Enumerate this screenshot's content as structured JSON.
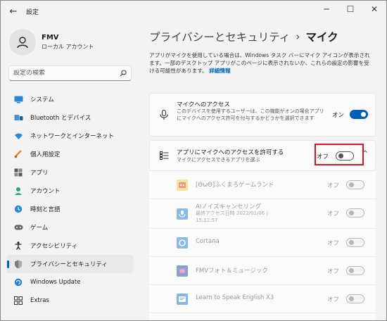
{
  "window": {
    "title": "設定",
    "back_icon": "←",
    "minimize_icon": "─",
    "maximize_icon": "☐",
    "close_icon": "✕"
  },
  "user": {
    "name": "FMV",
    "account_type": "ローカル アカウント"
  },
  "search": {
    "placeholder": "設定の検索"
  },
  "sidebar": {
    "items": [
      {
        "label": "システム",
        "icon": "system-icon"
      },
      {
        "label": "Bluetooth とデバイス",
        "icon": "bluetooth-icon"
      },
      {
        "label": "ネットワークとインターネット",
        "icon": "network-icon"
      },
      {
        "label": "個人用設定",
        "icon": "personalization-icon"
      },
      {
        "label": "アプリ",
        "icon": "apps-icon"
      },
      {
        "label": "アカウント",
        "icon": "account-icon"
      },
      {
        "label": "時刻と言語",
        "icon": "time-language-icon"
      },
      {
        "label": "ゲーム",
        "icon": "gaming-icon"
      },
      {
        "label": "アクセシビリティ",
        "icon": "accessibility-icon"
      },
      {
        "label": "プライバシーとセキュリティ",
        "icon": "privacy-shield-icon",
        "active": true
      },
      {
        "label": "Windows Update",
        "icon": "windows-update-icon"
      },
      {
        "label": "Extras",
        "icon": "extras-icon"
      }
    ]
  },
  "breadcrumb": {
    "parent": "プライバシーとセキュリティ",
    "separator": "›",
    "current": "マイク"
  },
  "description": {
    "text": "アプリがマイクを使用している場合は、Windows タスク バーにマイク アイコンが表示されます。一部のデスクトップ アプリがこのページに表示されないか、これらの設定の影響を受ける可能性があります。",
    "more_link": "詳細情報"
  },
  "mic_access": {
    "title": "マイクへのアクセス",
    "subtitle": "このデバイスを使用するユーザーは、この機能がオンの場合アプリにマイクへのアクセス許可を付与するかどうかを選択できます",
    "toggle_label": "オン",
    "state": "on"
  },
  "app_access": {
    "title": "アプリにマイクへのアクセスを許可する",
    "subtitle": "マイクにアクセスできるアプリを選ぶ",
    "toggle_label": "オフ",
    "state": "off",
    "expand_icon": "^"
  },
  "apps": [
    {
      "name": "[ΘωΘ]ふくまろゲームランド",
      "sub1": "",
      "sub2": "",
      "toggle_label": "オフ"
    },
    {
      "name": "AIノイズキャンセリング",
      "sub1": "最終アクセス日時 2022/01/06 |",
      "sub2": "15:11:57",
      "toggle_label": "オフ"
    },
    {
      "name": "Cortana",
      "sub1": "",
      "sub2": "",
      "toggle_label": "オフ"
    },
    {
      "name": "FMVフォト＆ミュージック",
      "sub1": "",
      "sub2": "",
      "toggle_label": "オフ"
    },
    {
      "name": "Learn to Speak English X3",
      "sub1": "",
      "sub2": "",
      "toggle_label": "オフ"
    }
  ],
  "colors": {
    "accent": "#005fb8",
    "highlight_box": "#e0141e",
    "background": "#f3f3f3",
    "card": "#fbfbfb"
  }
}
